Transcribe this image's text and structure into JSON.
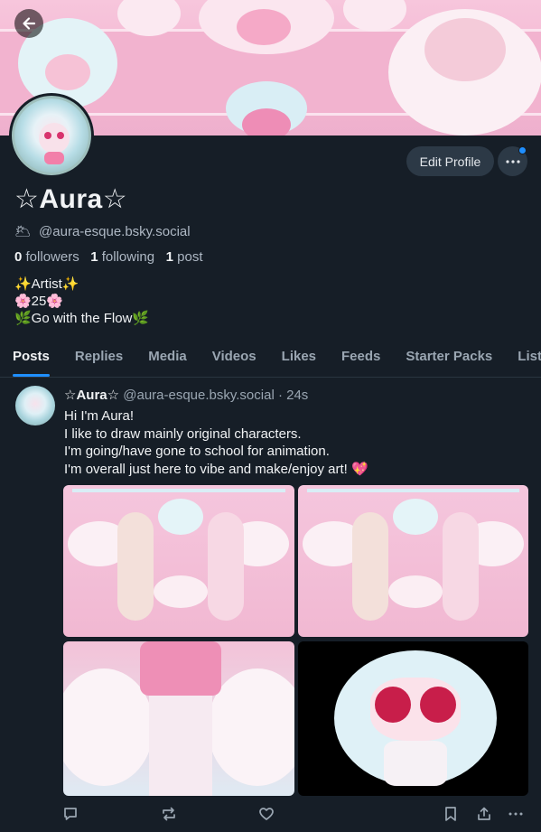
{
  "profile": {
    "display_name": "☆Aura☆",
    "handle_emoji": "🌥",
    "handle": "@aura-esque.bsky.social",
    "followers_count": "0",
    "followers_label": "followers",
    "following_count": "1",
    "following_label": "following",
    "posts_count": "1",
    "posts_label": "post",
    "bio": [
      "✨Artist✨",
      "🌸25🌸",
      "🌿Go with the Flow🌿"
    ]
  },
  "actions": {
    "edit_label": "Edit Profile"
  },
  "tabs": [
    "Posts",
    "Replies",
    "Media",
    "Videos",
    "Likes",
    "Feeds",
    "Starter Packs",
    "Lists"
  ],
  "post": {
    "author": "☆Aura☆",
    "handle": "@aura-esque.bsky.social",
    "separator": "·",
    "time": "24s",
    "lines": [
      "Hi I'm Aura!",
      "I like to draw mainly original characters.",
      "I'm going/have gone to school for animation.",
      "I'm overall just here to vibe and make/enjoy art! 💖"
    ]
  },
  "colors": {
    "accent": "#1f8fff",
    "background": "#161e27",
    "banner_pink": "#f2b3cf"
  },
  "icons": [
    "back-arrow-icon",
    "ellipsis-icon",
    "reply-icon",
    "repost-icon",
    "like-icon",
    "bookmark-icon",
    "share-icon",
    "more-icon"
  ]
}
